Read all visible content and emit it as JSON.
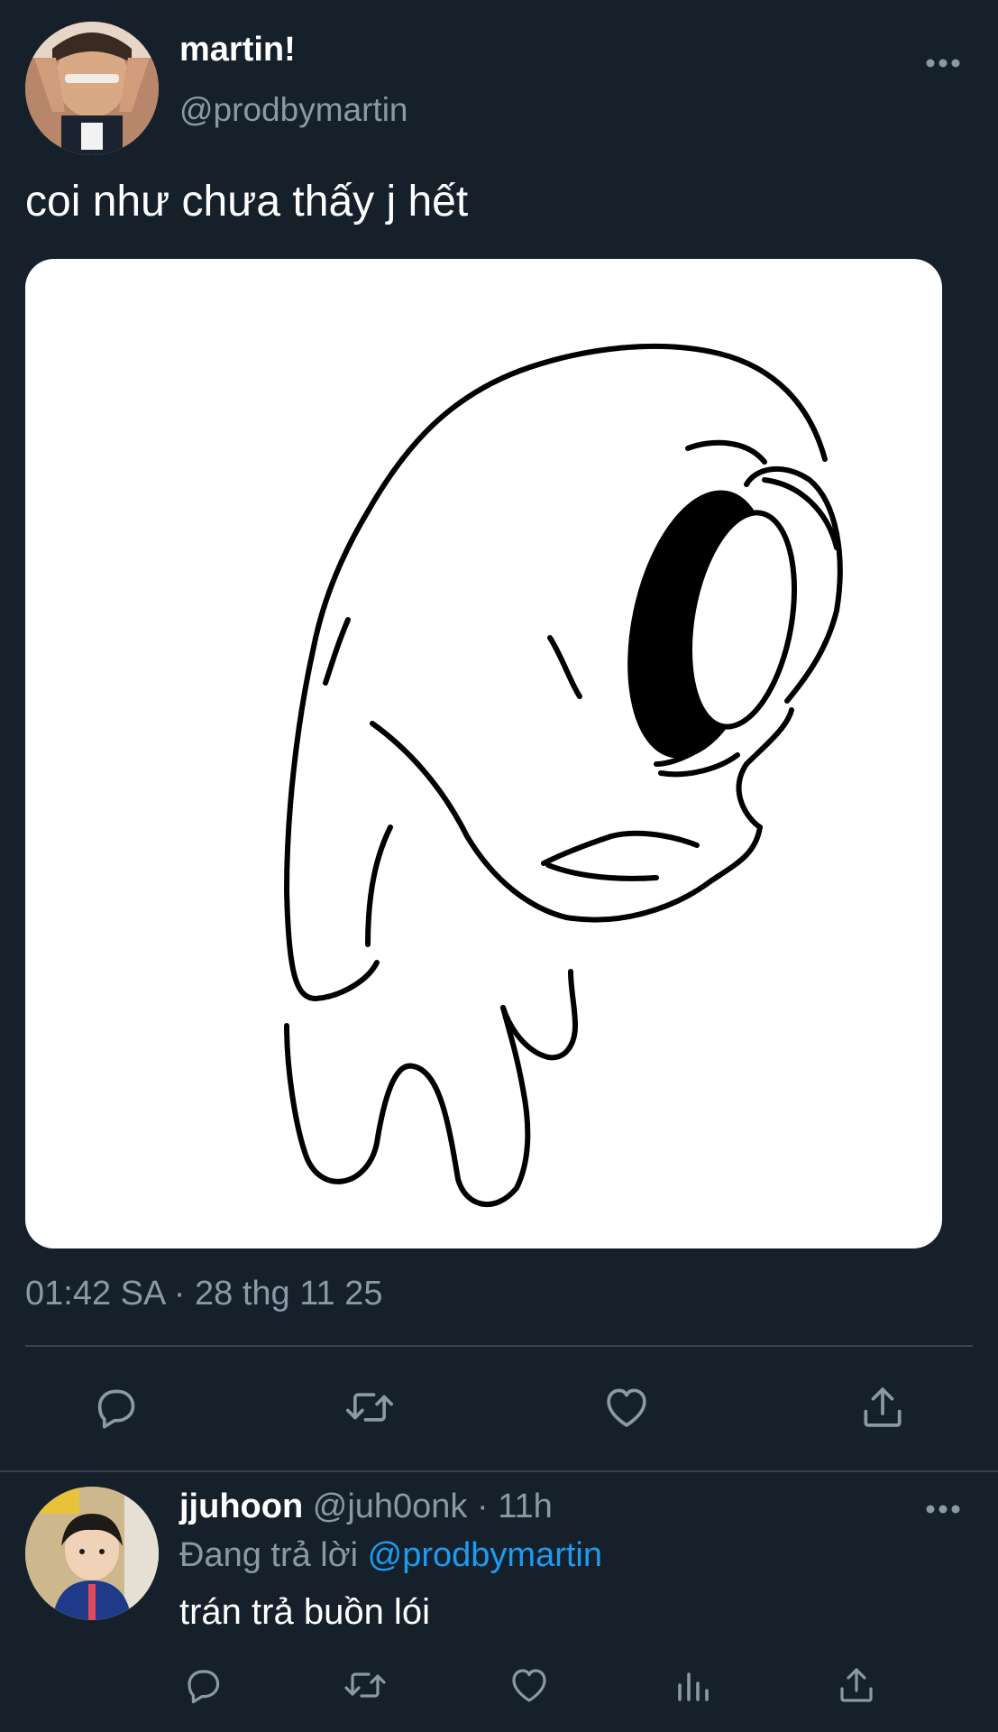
{
  "tweet": {
    "author": {
      "display_name": "martin!",
      "handle": "@prodbymartin"
    },
    "text": "coi như chưa thấy j hết",
    "timestamp": "01:42 SA · 28 thg 11 25",
    "media": {
      "icon": "sad-cartoon-blob-image"
    },
    "actions": [
      {
        "name": "reply",
        "icon": "reply-icon"
      },
      {
        "name": "retweet",
        "icon": "retweet-icon"
      },
      {
        "name": "like",
        "icon": "heart-icon"
      },
      {
        "name": "share",
        "icon": "share-icon"
      }
    ]
  },
  "reply": {
    "author": {
      "display_name": "jjuhoon",
      "handle": "@juh0onk",
      "time": "· 11h"
    },
    "replying_prefix": "Đang trả lời",
    "replying_to": "@prodbymartin",
    "text": "trán trả buồn lói",
    "actions": [
      {
        "name": "reply",
        "icon": "reply-icon"
      },
      {
        "name": "retweet",
        "icon": "retweet-icon"
      },
      {
        "name": "like",
        "icon": "heart-icon"
      },
      {
        "name": "views",
        "icon": "analytics-icon"
      },
      {
        "name": "share",
        "icon": "share-icon"
      }
    ]
  },
  "colors": {
    "background": "#15202b",
    "text_primary": "#ffffff",
    "text_secondary": "#8b98a5",
    "link": "#1d9bf0",
    "divider": "#38444d"
  }
}
